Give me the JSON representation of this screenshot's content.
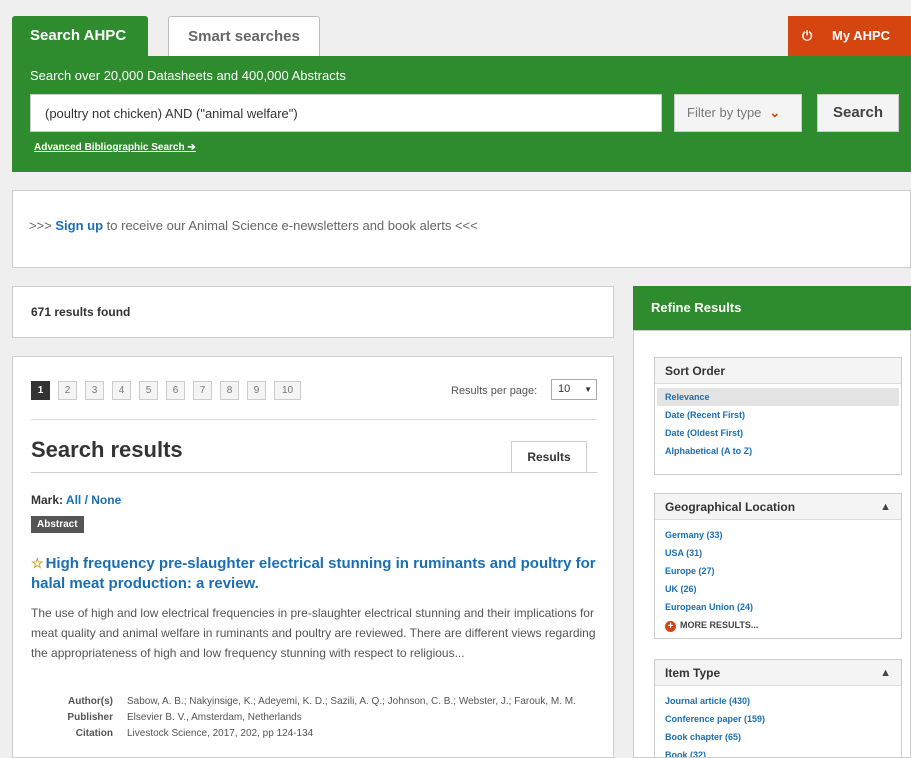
{
  "tabs": {
    "search": "Search AHPC",
    "smart": "Smart searches",
    "my": "My AHPC"
  },
  "search": {
    "description": "Search over 20,000 Datasheets and 400,000 Abstracts",
    "query": "(poultry not chicken) AND (\"animal welfare\")",
    "filter_label": "Filter by type",
    "button": "Search",
    "advanced": "Advanced Bibliographic Search ➔"
  },
  "signup": {
    "prefix": ">>> ",
    "link": "Sign up",
    "suffix": " to receive our Animal Science e-newsletters and book alerts <<<"
  },
  "results_count": "671 results found",
  "pagination": {
    "pages": [
      "1",
      "2",
      "3",
      "4",
      "5",
      "6",
      "7",
      "8",
      "9",
      "10"
    ],
    "per_page_label": "Results per page:",
    "per_page_value": "10"
  },
  "results": {
    "heading": "Search results",
    "tab": "Results",
    "mark_label": "Mark: ",
    "mark_all": "All",
    "mark_sep": " / ",
    "mark_none": "None",
    "items": [
      {
        "badge": "Abstract",
        "title": "High frequency pre-slaughter electrical stunning in ruminants and poultry for halal meat production: a review.",
        "abstract": "The use of high and low electrical frequencies in pre-slaughter electrical stunning and their implications for meat quality and animal welfare in ruminants and poultry are reviewed. There are different views regarding the appropriateness of high and low frequency stunning with respect to religious...",
        "authors_label": "Author(s)",
        "authors": "Sabow, A. B.; Nakyinsige, K.; Adeyemi, K. D.; Sazili, A. Q.; Johnson, C. B.; Webster, J.; Farouk, M. M.",
        "publisher_label": "Publisher",
        "publisher": "Elsevier B. V., Amsterdam, Netherlands",
        "citation_label": "Citation",
        "citation": "Livestock Science, 2017, 202, pp 124-134"
      }
    ]
  },
  "refine": {
    "heading": "Refine Results",
    "sort": {
      "title": "Sort Order",
      "options": [
        "Relevance",
        "Date (Recent First)",
        "Date (Oldest First)",
        "Alphabetical (A to Z)"
      ],
      "selected": "Relevance"
    },
    "geo": {
      "title": "Geographical Location",
      "items": [
        "Germany (33)",
        "USA (31)",
        "Europe (27)",
        "UK (26)",
        "European Union (24)"
      ],
      "more": "MORE RESULTS..."
    },
    "item_type": {
      "title": "Item Type",
      "items": [
        "Journal article (430)",
        "Conference paper (159)",
        "Book chapter (65)",
        "Book (32)"
      ]
    }
  },
  "icons": {
    "power": "power-icon",
    "chevron": "chevron-down-icon",
    "star": "star-outline-icon",
    "plus": "plus-circle-icon",
    "collapse": "chevron-up-icon"
  },
  "colors": {
    "green": "#2e8b2e",
    "orange": "#d64510",
    "link": "#1a6fb4"
  }
}
